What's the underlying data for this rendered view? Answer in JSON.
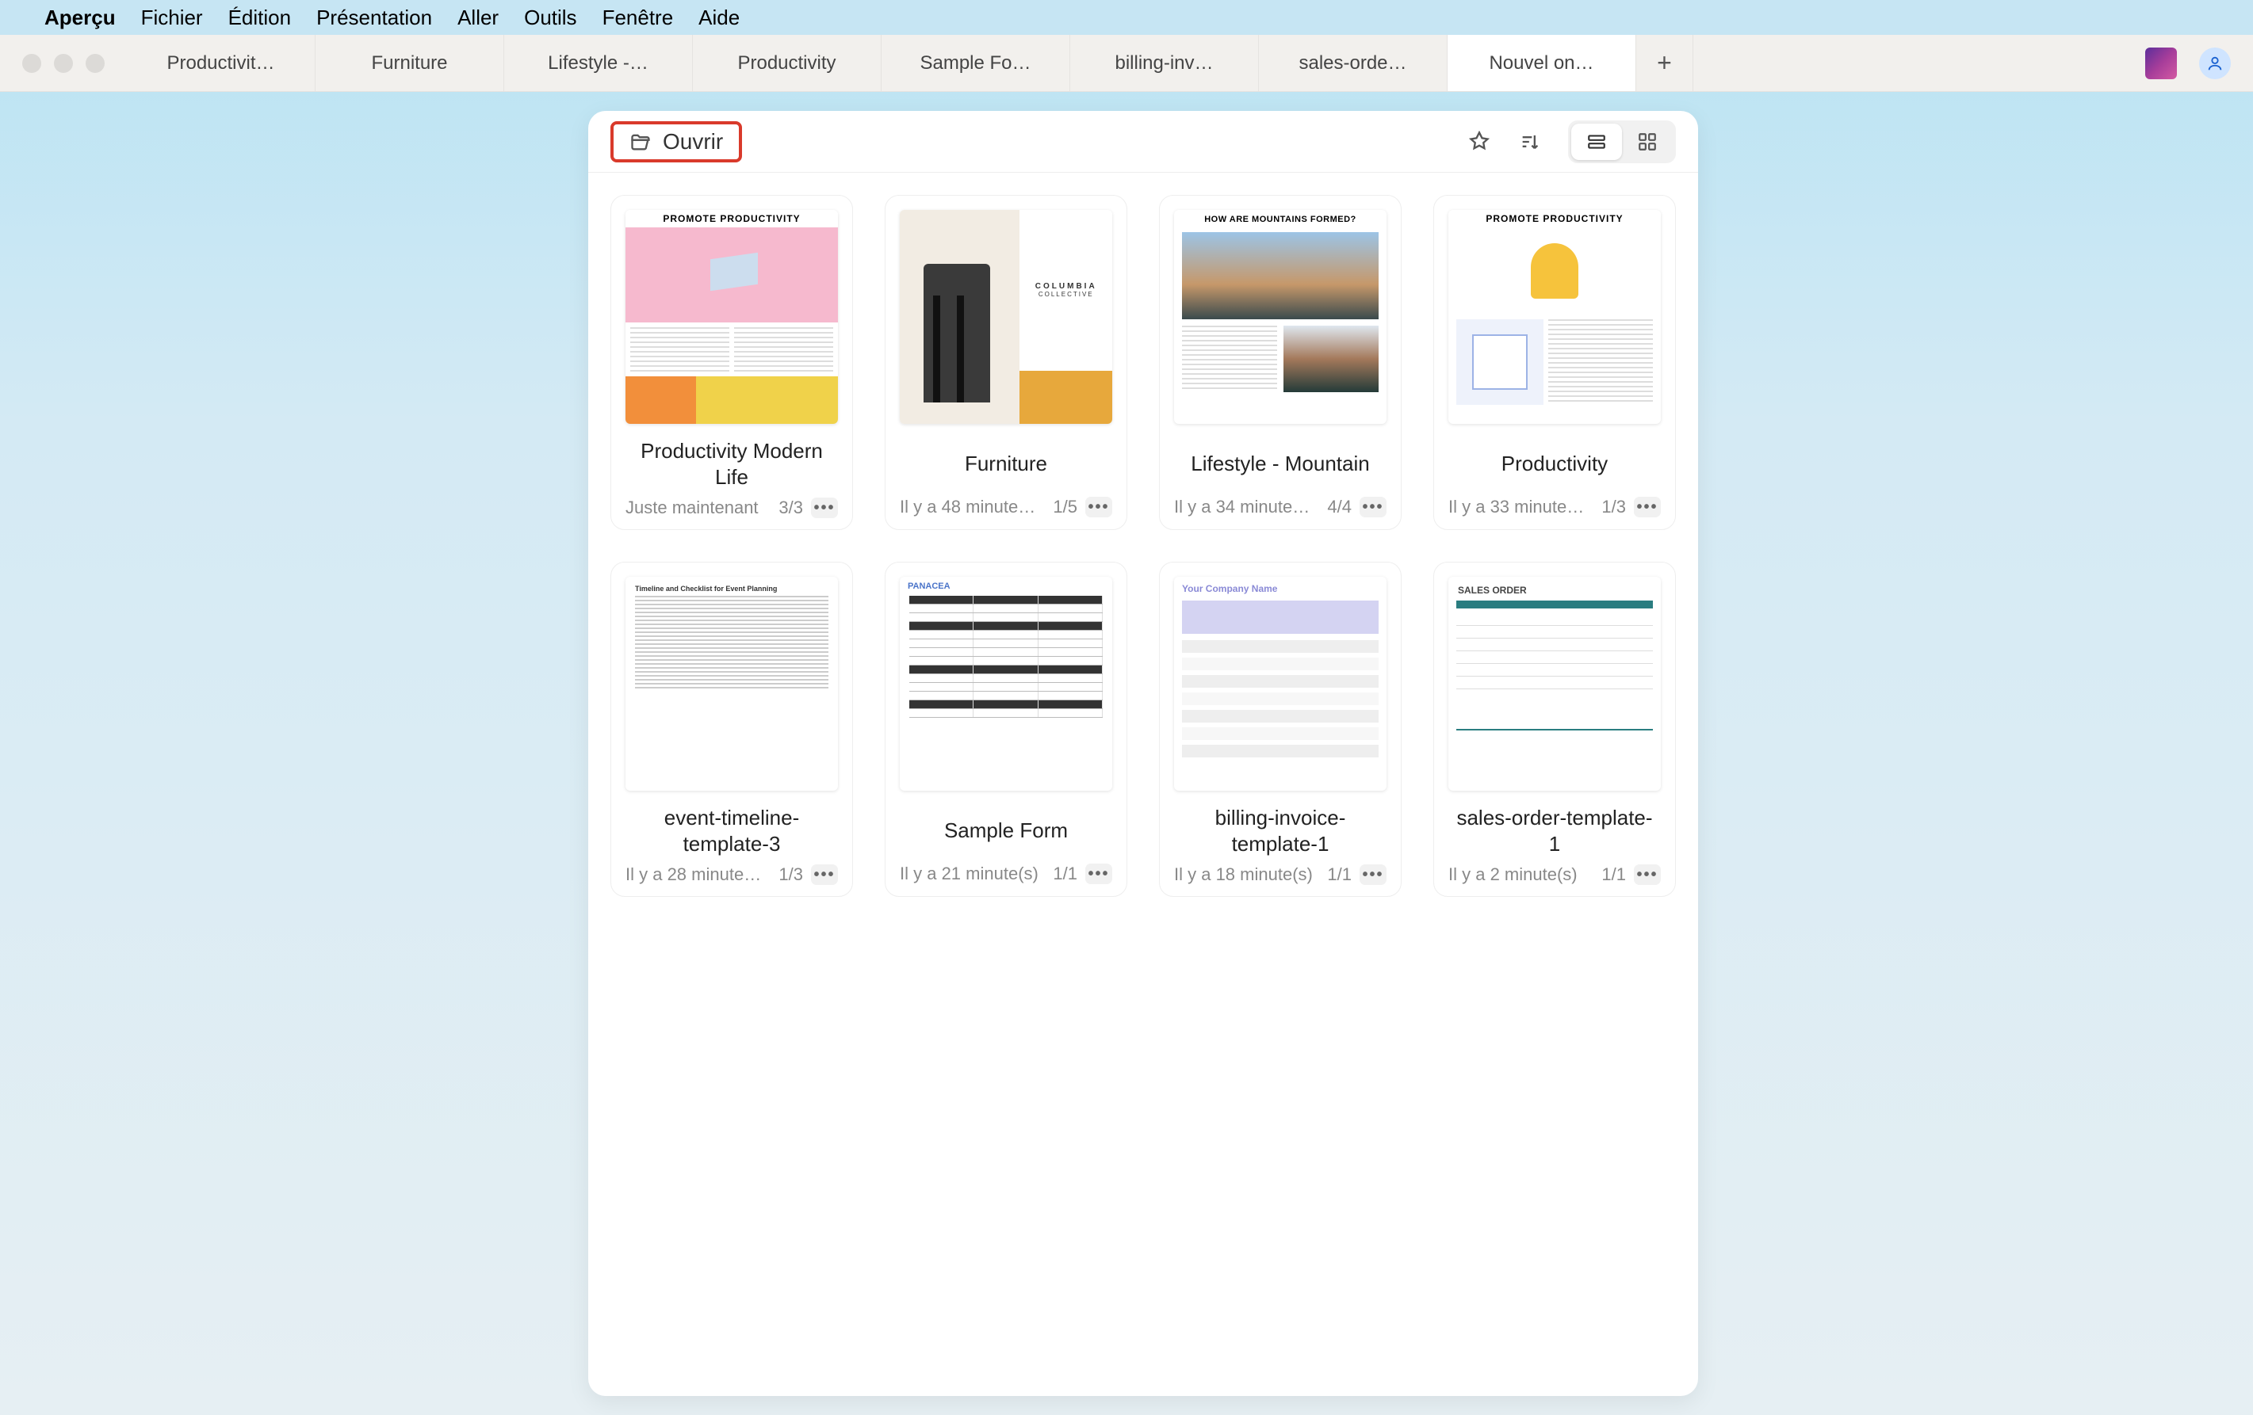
{
  "menubar": {
    "app": "Aperçu",
    "items": [
      "Fichier",
      "Édition",
      "Présentation",
      "Aller",
      "Outils",
      "Fenêtre",
      "Aide"
    ]
  },
  "tabs": {
    "list": [
      "Productivit…",
      "Furniture",
      "Lifestyle -…",
      "Productivity",
      "Sample Fo…",
      "billing-inv…",
      "sales-orde…",
      "Nouvel on…"
    ],
    "active_index": 7
  },
  "toolbar": {
    "open_label": "Ouvrir"
  },
  "documents": [
    {
      "title": "Productivity Modern Life",
      "time": "Juste maintenant",
      "pages": "3/3",
      "thumb": "t1",
      "banner": "PROMOTE PRODUCTIVITY"
    },
    {
      "title": "Furniture",
      "time": "Il y a 48 minute…",
      "pages": "1/5",
      "thumb": "t2",
      "banner": "COLUMBIA"
    },
    {
      "title": "Lifestyle - Mountain",
      "time": "Il y a 34 minute…",
      "pages": "4/4",
      "thumb": "t3",
      "banner": "HOW ARE MOUNTAINS FORMED?"
    },
    {
      "title": "Productivity",
      "time": "Il y a 33 minute…",
      "pages": "1/3",
      "thumb": "t4",
      "banner": "PROMOTE PRODUCTIVITY"
    },
    {
      "title": "event-timeline-template-3",
      "time": "Il y a 28 minute…",
      "pages": "1/3",
      "thumb": "t5",
      "banner": "Timeline and Checklist for Event Planning"
    },
    {
      "title": "Sample Form",
      "time": "Il y a 21 minute(s)",
      "pages": "1/1",
      "thumb": "t6",
      "banner": "PANACEA"
    },
    {
      "title": "billing-invoice-template-1",
      "time": "Il y a 18 minute(s)",
      "pages": "1/1",
      "thumb": "t7",
      "banner": "Your Company Name"
    },
    {
      "title": "sales-order-template-1",
      "time": "Il y a 2 minute(s)",
      "pages": "1/1",
      "thumb": "t8",
      "banner": "SALES ORDER"
    }
  ]
}
